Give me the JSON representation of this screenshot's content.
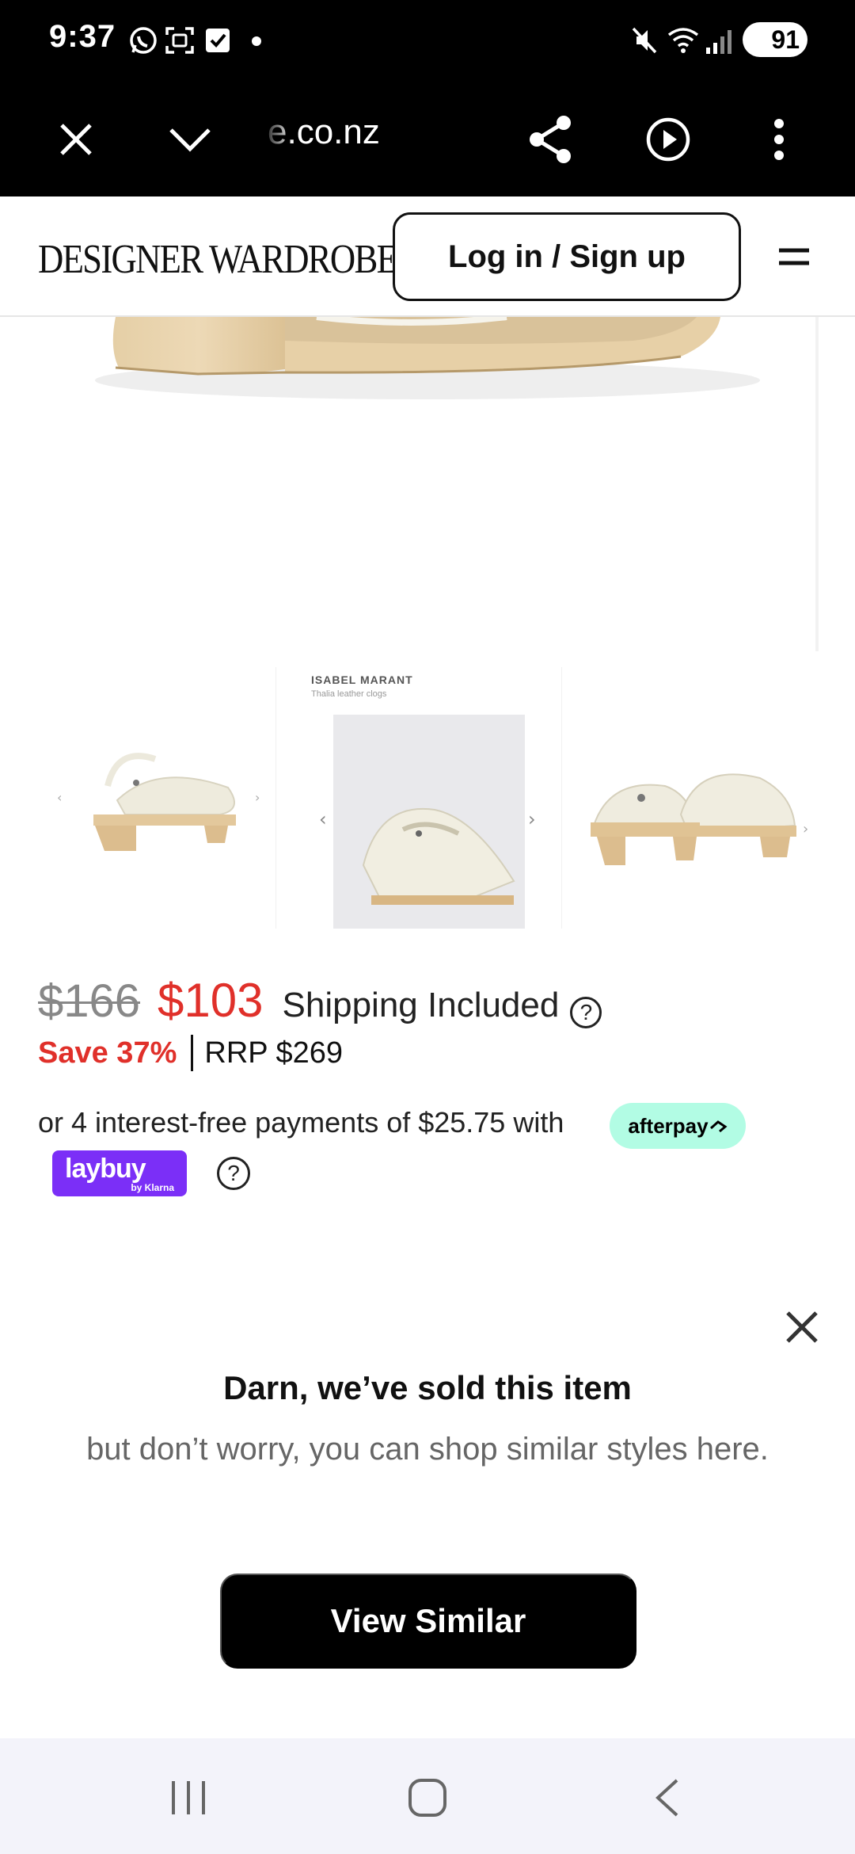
{
  "status_bar": {
    "time": "9:37",
    "battery": "91",
    "icons": [
      "whatsapp-icon",
      "screenshot-icon",
      "check-icon",
      "mute-icon",
      "wifi-icon",
      "signal-icon",
      "battery-icon"
    ]
  },
  "browser": {
    "url": "e.co.nz",
    "icons": [
      "close-icon",
      "chevron-down-icon",
      "share-icon",
      "play-icon",
      "more-vertical-icon"
    ]
  },
  "header": {
    "logo": "DESIGNER WARDROBE",
    "login_label": "Log in / Sign up",
    "menu_icon": "menu-icon"
  },
  "gallery": {
    "thumb_caption_brand": "ISABEL MARANT",
    "thumb_caption_item": "Thalia leather clogs"
  },
  "price": {
    "original": "$166",
    "current": "$103",
    "shipping": "Shipping Included",
    "help": "?",
    "save": "Save 37%",
    "rrp": "RRP $269"
  },
  "payments": {
    "installments_text": "or 4 interest-free payments of $25.75 with",
    "afterpay_label": "afterpay",
    "laybuy_label": "laybuy",
    "laybuy_sub": "by Klarna",
    "help": "?"
  },
  "sold": {
    "title": "Darn, we’ve sold this item",
    "subtitle": "but don’t worry, you can shop similar styles here.",
    "button_label": "View Similar"
  },
  "colors": {
    "accent_red": "#e0302a",
    "afterpay_mint": "#b2fce4",
    "laybuy_purple": "#7b2ff7"
  }
}
